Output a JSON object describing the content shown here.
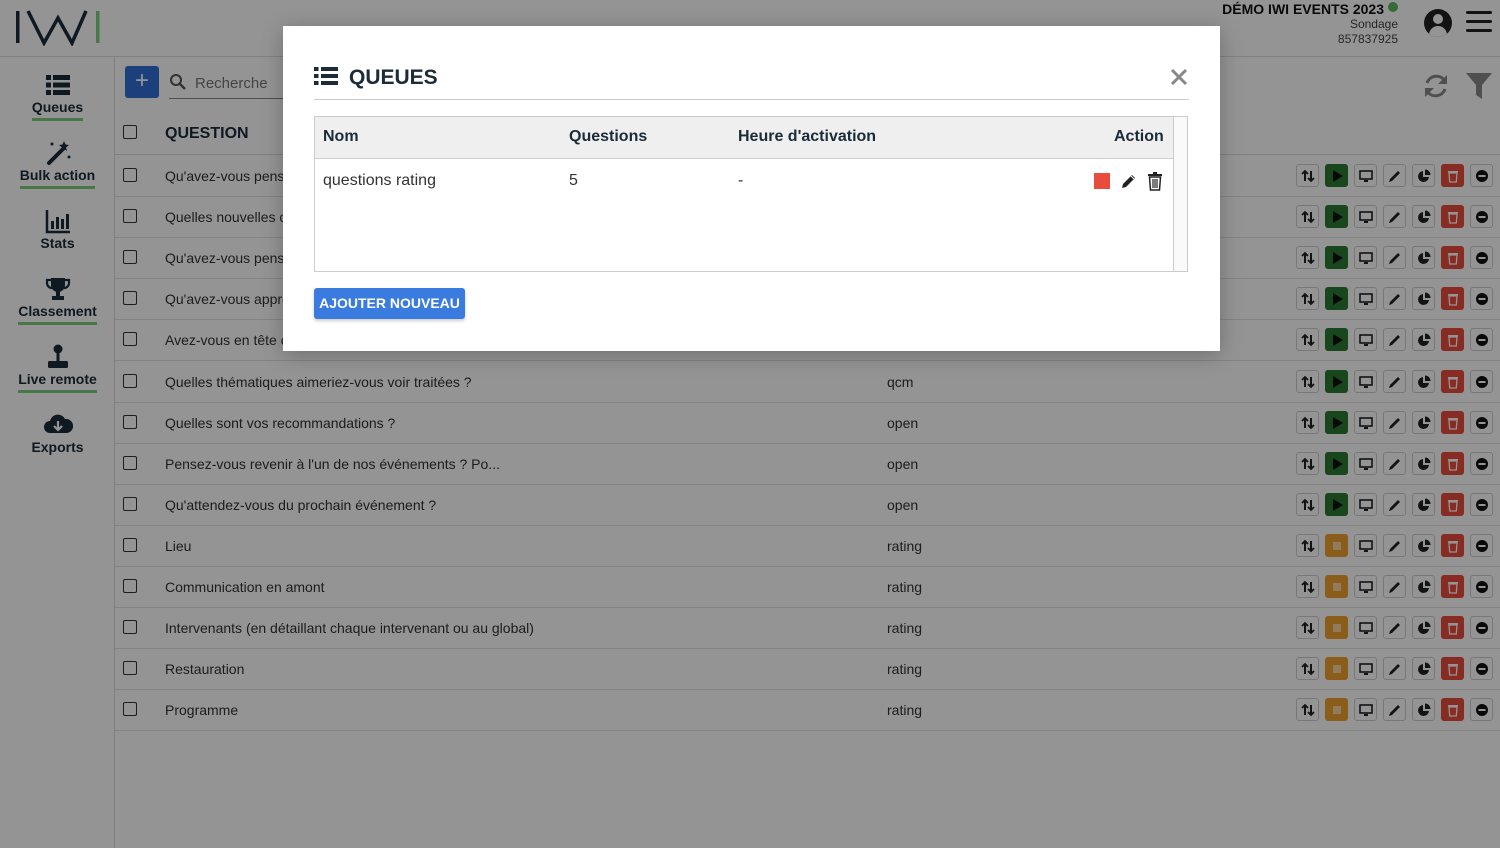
{
  "header": {
    "event_title": "DÉMO IWI EVENTS 2023",
    "event_type": "Sondage",
    "event_code": "857837925"
  },
  "sidebar": {
    "items": [
      {
        "label": "Queues",
        "icon": "list-icon"
      },
      {
        "label": "Bulk action",
        "icon": "magic-wand-icon"
      },
      {
        "label": "Stats",
        "icon": "bar-chart-icon"
      },
      {
        "label": "Classement",
        "icon": "trophy-icon"
      },
      {
        "label": "Live remote",
        "icon": "joystick-icon"
      },
      {
        "label": "Exports",
        "icon": "cloud-download-icon"
      }
    ]
  },
  "toolbar": {
    "add_label": "+",
    "search_placeholder": "Recherche"
  },
  "table": {
    "header_question": "QUESTION",
    "rows": [
      {
        "question": "Qu'avez-vous pensé",
        "type": "",
        "status": "play"
      },
      {
        "question": "Quelles nouvelles c",
        "type": "",
        "status": "play"
      },
      {
        "question": "Qu'avez-vous pensé",
        "type": "",
        "status": "play"
      },
      {
        "question": "Qu'avez-vous appré",
        "type": "",
        "status": "play"
      },
      {
        "question": "Avez-vous en tête c",
        "type": "",
        "status": "play"
      },
      {
        "question": "Quelles thématiques aimeriez-vous voir traitées ?",
        "type": "qcm",
        "status": "play"
      },
      {
        "question": "Quelles sont vos recommandations ?",
        "type": "open",
        "status": "play"
      },
      {
        "question": "Pensez-vous revenir à l'un de nos événements ? Po...",
        "type": "open",
        "status": "play"
      },
      {
        "question": "Qu'attendez-vous du prochain événement ?",
        "type": "open",
        "status": "play"
      },
      {
        "question": "Lieu",
        "type": "rating",
        "status": "stop"
      },
      {
        "question": "Communication en amont",
        "type": "rating",
        "status": "stop"
      },
      {
        "question": "Intervenants (en détaillant chaque intervenant ou au global)",
        "type": "rating",
        "status": "stop"
      },
      {
        "question": "Restauration",
        "type": "rating",
        "status": "stop"
      },
      {
        "question": "Programme",
        "type": "rating",
        "status": "stop"
      }
    ]
  },
  "modal": {
    "title": "QUEUES",
    "columns": {
      "name": "Nom",
      "questions": "Questions",
      "activation": "Heure d'activation",
      "action": "Action"
    },
    "rows": [
      {
        "name": "questions rating",
        "questions": "5",
        "activation": "-"
      }
    ],
    "add_button": "AJOUTER NOUVEAU"
  },
  "colors": {
    "primary": "#2f6fd6",
    "play": "#2b7a32",
    "stop": "#f0a030",
    "delete": "#e74c3c",
    "nav_underline": "#7dcf7d"
  }
}
